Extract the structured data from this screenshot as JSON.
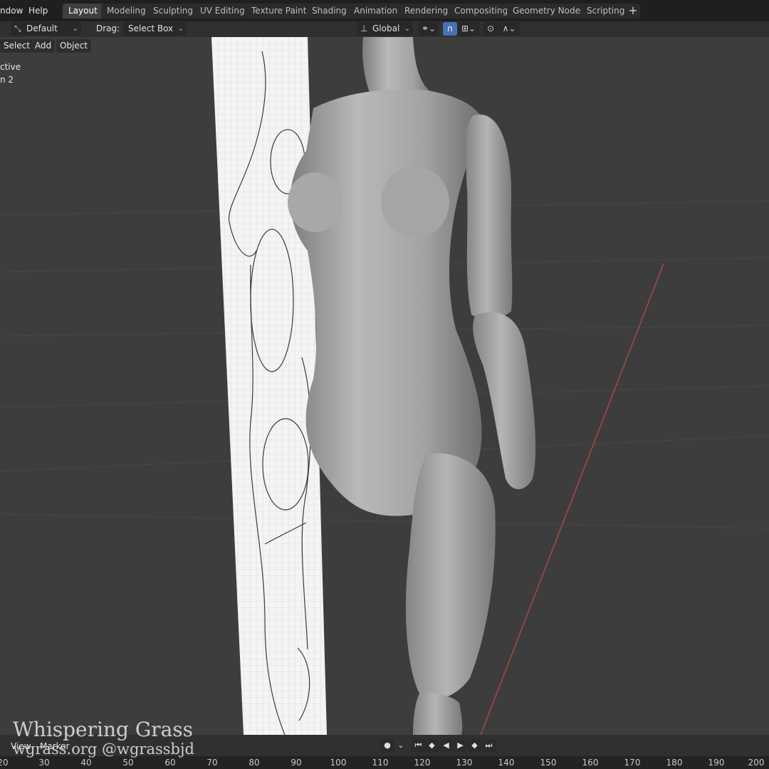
{
  "menubar": {
    "items": [
      "ndow",
      "Help"
    ]
  },
  "workspaces": {
    "tabs": [
      "Layout",
      "Modeling",
      "Sculpting",
      "UV Editing",
      "Texture Paint",
      "Shading",
      "Animation",
      "Rendering",
      "Compositing",
      "Geometry Nodes",
      "Scripting"
    ],
    "active": "Layout",
    "add_label": "+"
  },
  "toolbar": {
    "orientation_value": "Default",
    "drag_label": "Drag:",
    "drag_value": "Select Box",
    "transform_orientation": "Global"
  },
  "viewport_header": {
    "menus": [
      "Select",
      "Add",
      "Object"
    ]
  },
  "viewport_overlay": {
    "line1": "ctive",
    "line2": "n 2"
  },
  "timeline": {
    "menus": [
      "View",
      "Marker"
    ],
    "ticks": [
      "20",
      "30",
      "40",
      "50",
      "60",
      "70",
      "80",
      "90",
      "100",
      "110",
      "120",
      "130",
      "140",
      "150",
      "160",
      "170",
      "180",
      "190",
      "200"
    ]
  },
  "watermark": {
    "line1": "Whispering Grass",
    "line2": "wgrass.org @wgrassbjd"
  },
  "colors": {
    "active_tab": "#404040",
    "accent_blue": "#4772b3",
    "x_axis_red": "#b43c3c",
    "viewport_bg": "#3d3d3d"
  }
}
